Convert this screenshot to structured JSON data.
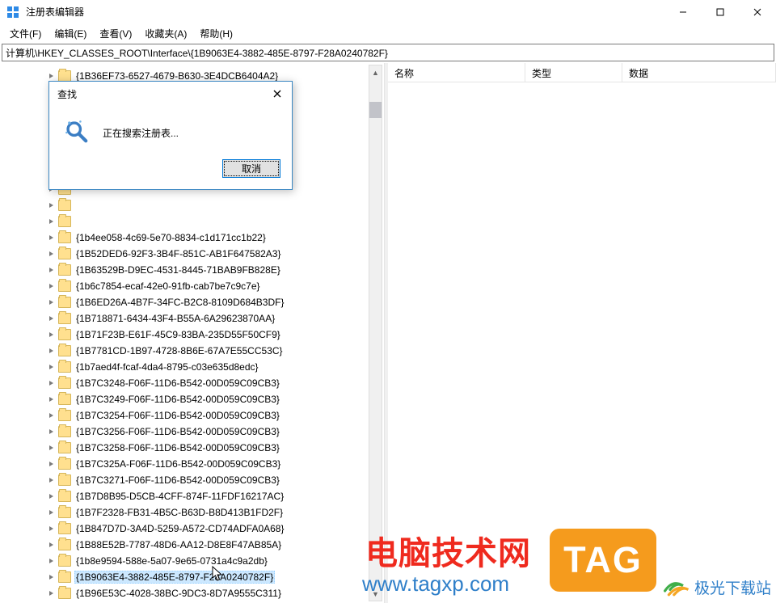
{
  "window": {
    "title": "注册表编辑器"
  },
  "menu": {
    "file": "文件(F)",
    "edit": "编辑(E)",
    "view": "查看(V)",
    "fav": "收藏夹(A)",
    "help": "帮助(H)"
  },
  "address": "计算机\\HKEY_CLASSES_ROOT\\Interface\\{1B9063E4-3882-485E-8797-F28A0240782F}",
  "columns": {
    "name": "名称",
    "type": "类型",
    "data": "数据"
  },
  "tree": [
    "{1B36EF73-6527-4679-B630-3E4DCB6404A2}",
    "",
    "",
    "",
    "",
    "",
    "",
    "",
    "",
    "",
    "{1b4ee058-4c69-5e70-8834-c1d171cc1b22}",
    "{1B52DED6-92F3-3B4F-851C-AB1F647582A3}",
    "{1B63529B-D9EC-4531-8445-71BAB9FB828E}",
    "{1b6c7854-ecaf-42e0-91fb-cab7be7c9c7e}",
    "{1B6ED26A-4B7F-34FC-B2C8-8109D684B3DF}",
    "{1B718871-6434-43F4-B55A-6A29623870AA}",
    "{1B71F23B-E61F-45C9-83BA-235D55F50CF9}",
    "{1B7781CD-1B97-4728-8B6E-67A7E55CC53C}",
    "{1b7aed4f-fcaf-4da4-8795-c03e635d8edc}",
    "{1B7C3248-F06F-11D6-B542-00D059C09CB3}",
    "{1B7C3249-F06F-11D6-B542-00D059C09CB3}",
    "{1B7C3254-F06F-11D6-B542-00D059C09CB3}",
    "{1B7C3256-F06F-11D6-B542-00D059C09CB3}",
    "{1B7C3258-F06F-11D6-B542-00D059C09CB3}",
    "{1B7C325A-F06F-11D6-B542-00D059C09CB3}",
    "{1B7C3271-F06F-11D6-B542-00D059C09CB3}",
    "{1B7D8B95-D5CB-4CFF-874F-11FDF16217AC}",
    "{1B7F2328-FB31-4B5C-B63D-B8D413B1FD2F}",
    "{1B847D7D-3A4D-5259-A572-CD74ADFA0A68}",
    "{1B88E52B-7787-48D6-AA12-D8E8F47AB85A}",
    "{1b8e9594-588e-5a07-9e65-0731a4c9a2db}",
    "{1B9063E4-3882-485E-8797-F28A0240782F}",
    "{1B96E53C-4028-38BC-9DC3-8D7A9555C311}"
  ],
  "selected_index": 31,
  "dialog": {
    "title": "查找",
    "message": "正在搜索注册表...",
    "cancel": "取消"
  },
  "watermark": {
    "text1": "电脑技术网",
    "url": "www.tagxp.com",
    "tag": "TAG",
    "xz": "极光下载站"
  }
}
